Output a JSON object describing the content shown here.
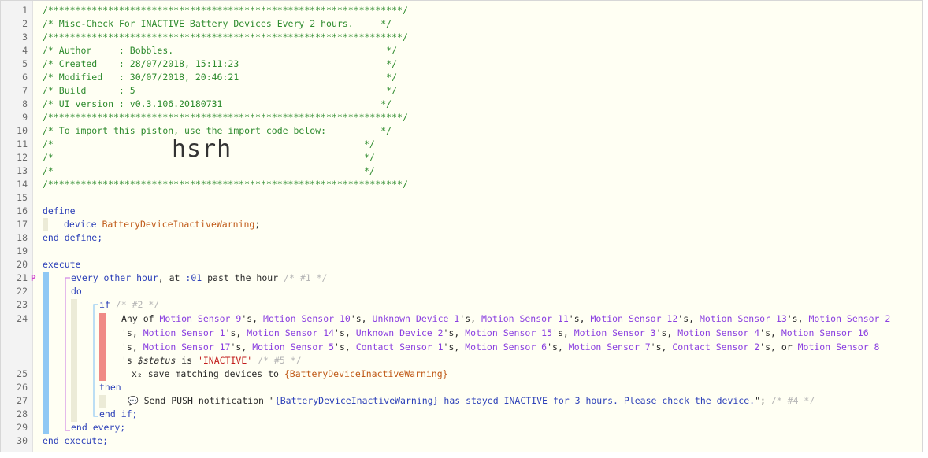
{
  "line_numbers": [
    "1",
    "2",
    "3",
    "4",
    "5",
    "6",
    "7",
    "8",
    "9",
    "10",
    "11",
    "12",
    "13",
    "14",
    "15",
    "16",
    "17",
    "18",
    "19",
    "20",
    "21",
    "22",
    "23",
    "24",
    "25",
    "26",
    "27",
    "28",
    "29",
    "30"
  ],
  "gutter_marker": "P",
  "header": {
    "border": "/*****************************************************************/",
    "title": "/* Misc-Check For INACTIVE Battery Devices Every 2 hours.     */",
    "author": "/* Author     : Bobbles.                                       */",
    "created": "/* Created    : 28/07/2018, 15:11:23                           */",
    "modified": "/* Modified   : 30/07/2018, 20:46:21                           */",
    "build": "/* Build      : 5                                              */",
    "ui_version": "/* UI version : v0.3.106.20180731                             */",
    "import_note": "/* To import this piston, use the import code below:          */",
    "blank_left": "/*",
    "blank_right": "*/",
    "import_code": "hsrh"
  },
  "code": {
    "define": "define",
    "device_kw": "device",
    "device_var": "BatteryDeviceInactiveWarning",
    "semicolon": ";",
    "end_define": "end define;",
    "execute": "execute",
    "every": "every other hour",
    "at": ", at ",
    "at_val": ":01",
    "past_hour": " past the hour ",
    "every_comment": "/* #1 */",
    "do": "do",
    "if": "if",
    "if_comment": "/* #2 */",
    "anyof": "Any of ",
    "devices": [
      "Motion Sensor 9",
      "Motion Sensor 10",
      "Unknown Device 1",
      "Motion Sensor 11",
      "Motion Sensor 12",
      "Motion Sensor 13",
      "Motion Sensor 2",
      "Motion Sensor 1",
      "Motion Sensor 14",
      "Unknown Device 2",
      "Motion Sensor 15",
      "Motion Sensor 3",
      "Motion Sensor 4",
      "Motion Sensor 16",
      "Motion Sensor 17",
      "Motion Sensor 5",
      "Contact Sensor 1",
      "Motion Sensor 6",
      "Motion Sensor 7",
      "Contact Sensor 2",
      "Motion Sensor 8"
    ],
    "poss": "'s, ",
    "poss_last": "'s, or ",
    "status_prefix": "'s ",
    "status_attr": "$status",
    "is": " is ",
    "status_value": "'INACTIVE'",
    "cond_comment": "/* #5 */",
    "save_icon": "x₂",
    "save_text": " save matching devices to ",
    "save_var": "{BatteryDeviceInactiveWarning}",
    "then": "then",
    "chat_icon": "💬",
    "send_text": " Send PUSH notification \"",
    "send_msg": "{BatteryDeviceInactiveWarning} has stayed INACTIVE for 3 hours. Please check the device.",
    "send_end": "\";",
    "send_comment": "/* #4 */",
    "end_if": "end if;",
    "end_every": "end every;",
    "end_execute": "end execute;"
  },
  "colors": {
    "comment": "#2e8b2e",
    "keyword": "#2b3fb8",
    "device": "#8a3fe0",
    "variable": "#c05a18",
    "string": "#c21c1c",
    "bar_blue": "#8fc8f4",
    "bar_purple": "#d28be6",
    "bar_beige": "#ecebd7",
    "bar_red": "#f08a86"
  }
}
